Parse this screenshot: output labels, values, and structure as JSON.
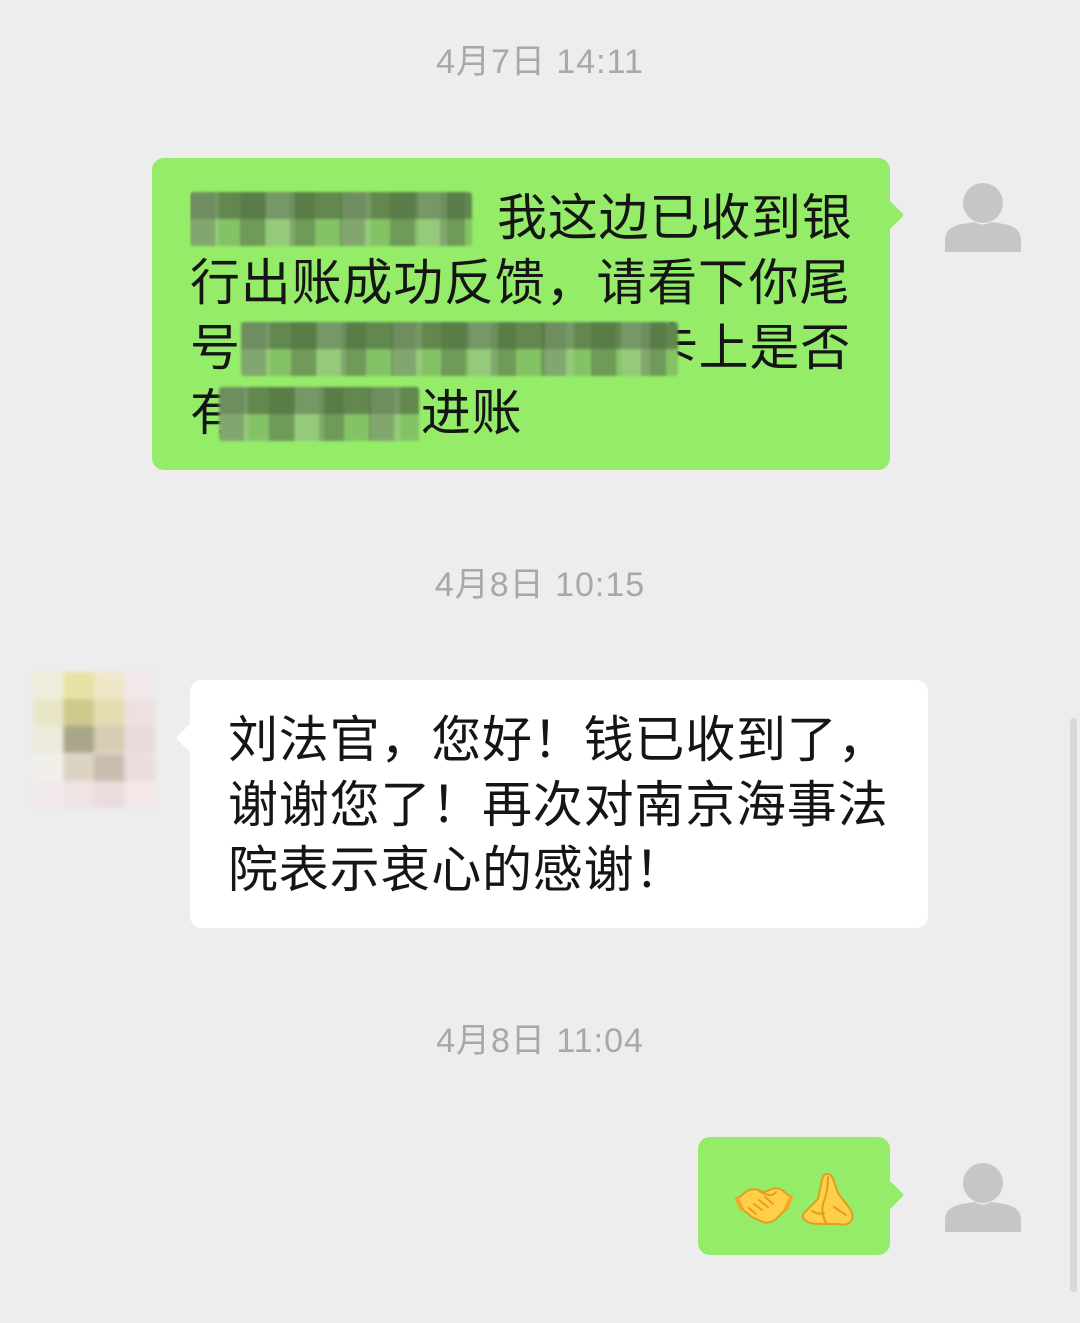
{
  "colors": {
    "background": "#ededed",
    "sent_bubble": "#95ec69",
    "received_bubble": "#ffffff",
    "timestamp_text": "#a8a8a8",
    "message_text": "#151515"
  },
  "chat": {
    "timestamp_1": "4月7日 14:11",
    "sent_message_1": {
      "avatar_icon": "default-avatar-icon",
      "lines": [
        [
          {
            "redacted": true
          },
          {
            "text": "我这边已收到银"
          }
        ],
        [
          {
            "text": "行出账成功反馈，请看下你尾"
          }
        ],
        [
          {
            "text": "号"
          },
          {
            "redacted": true
          },
          {
            "text": "卡上是否"
          }
        ],
        [
          {
            "text": "有"
          },
          {
            "redacted": true
          },
          {
            "text": "进账"
          }
        ]
      ]
    },
    "timestamp_2": "4月8日 10:15",
    "received_message": {
      "avatar_redacted": true,
      "lines": [
        "刘法官，您好！钱已收到了，",
        "谢谢您了！再次对南京海事法",
        "院表示衷心的感谢！"
      ]
    },
    "timestamp_3": "4月8日 11:04",
    "sent_message_2": {
      "avatar_icon": "default-avatar-icon",
      "emoji_icons": [
        "handshake-emoji-icon",
        "folded-hands-emoji-icon"
      ]
    }
  }
}
